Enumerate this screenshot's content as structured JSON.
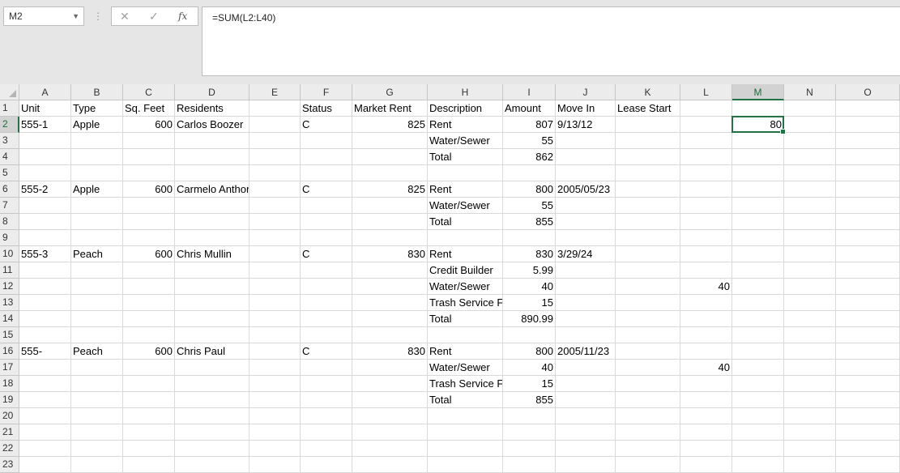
{
  "name_box": "M2",
  "formula": "=SUM(L2:L40)",
  "columns": [
    "A",
    "B",
    "C",
    "D",
    "E",
    "F",
    "G",
    "H",
    "I",
    "J",
    "K",
    "L",
    "M",
    "N",
    "O"
  ],
  "rows": [
    {
      "n": "1",
      "cells": {
        "A": "Unit",
        "B": "Type",
        "C": "Sq. Feet",
        "D": "Residents",
        "F": "Status",
        "G": "Market Rent",
        "H": "Description",
        "I": "Amount",
        "J": "Move In",
        "K": "Lease Start"
      }
    },
    {
      "n": "2",
      "cells": {
        "A": "555-1",
        "B": "Apple",
        "C": "600",
        "D": "Carlos Boozer",
        "F": "C",
        "G": "825",
        "H": "Rent",
        "I": "807",
        "J": "9/13/12",
        "M": "80"
      }
    },
    {
      "n": "3",
      "cells": {
        "H": "Water/Sewer",
        "I": "55"
      }
    },
    {
      "n": "4",
      "cells": {
        "H": "Total",
        "I": "862"
      }
    },
    {
      "n": "5",
      "cells": {}
    },
    {
      "n": "6",
      "cells": {
        "A": "555-2",
        "B": "Apple",
        "C": "600",
        "D": "Carmelo Anthony",
        "F": "C",
        "G": "825",
        "H": "Rent",
        "I": "800",
        "J": "2005/05/23"
      }
    },
    {
      "n": "7",
      "cells": {
        "H": "Water/Sewer",
        "I": "55"
      }
    },
    {
      "n": "8",
      "cells": {
        "H": "Total",
        "I": "855"
      }
    },
    {
      "n": "9",
      "cells": {}
    },
    {
      "n": "10",
      "cells": {
        "A": "555-3",
        "B": "Peach",
        "C": "600",
        "D": "Chris Mullin",
        "F": "C",
        "G": "830",
        "H": "Rent",
        "I": "830",
        "J": "3/29/24"
      }
    },
    {
      "n": "11",
      "cells": {
        "H": "Credit Builder",
        "I": "5.99"
      }
    },
    {
      "n": "12",
      "cells": {
        "H": "Water/Sewer",
        "I": "40",
        "L": "40"
      }
    },
    {
      "n": "13",
      "cells": {
        "H": "Trash Service F",
        "I": "15"
      }
    },
    {
      "n": "14",
      "cells": {
        "H": "Total",
        "I": "890.99"
      }
    },
    {
      "n": "15",
      "cells": {}
    },
    {
      "n": "16",
      "cells": {
        "A": "555-",
        "B": "Peach",
        "C": "600",
        "D": "Chris Paul",
        "F": "C",
        "G": "830",
        "H": "Rent",
        "I": "800",
        "J": "2005/11/23"
      }
    },
    {
      "n": "17",
      "cells": {
        "H": "Water/Sewer",
        "I": "40",
        "L": "40"
      }
    },
    {
      "n": "18",
      "cells": {
        "H": "Trash Service F",
        "I": "15"
      }
    },
    {
      "n": "19",
      "cells": {
        "H": "Total",
        "I": "855"
      }
    },
    {
      "n": "20",
      "cells": {}
    },
    {
      "n": "21",
      "cells": {}
    },
    {
      "n": "22",
      "cells": {}
    },
    {
      "n": "23",
      "cells": {}
    }
  ],
  "selected_column": "M",
  "selected_row": "2",
  "numeric_columns": [
    "C",
    "G",
    "I",
    "L",
    "M"
  ],
  "accent_color": "#217346"
}
